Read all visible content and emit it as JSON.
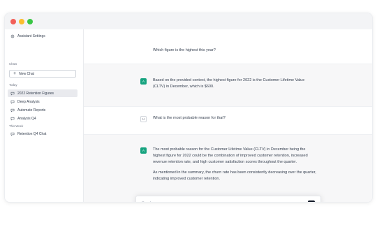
{
  "sidebar": {
    "settings_label": "Assistant Settings",
    "chats_caption": "Chats",
    "new_chat_label": "New Chat",
    "today_caption": "Today",
    "today_items": [
      {
        "label": "2022 Retention Figures",
        "active": true
      },
      {
        "label": "Deep Analysis",
        "active": false
      },
      {
        "label": "Automate Reports",
        "active": false
      },
      {
        "label": "Analysis Q4",
        "active": false
      }
    ],
    "week_caption": "This Week",
    "week_items": [
      {
        "label": "Retention Q4 Chat",
        "active": false
      }
    ]
  },
  "conversation": [
    {
      "role": "user",
      "avatar": "",
      "text": "Which figure is the highest this year?"
    },
    {
      "role": "assistant",
      "avatar": "A",
      "text": "Based on the provided context, the highest figure for 2022 is the Customer Lifetime Value (CLTV) in December, which is $600."
    },
    {
      "role": "user",
      "avatar": "U",
      "text": "What is the most probable reason for that?"
    },
    {
      "role": "assistant",
      "avatar": "A",
      "paragraphs": [
        "The most probable reason for the Customer Lifetime Value (CLTV) in December being the highest figure for 2022 could be the combination of improved customer retention, increased revenue retention rate, and high customer satisfaction scores throughout the quarter.",
        "As mentioned in the summary, the churn rate has been consistently decreasing over the quarter, indicating improved customer retention."
      ]
    }
  ],
  "composer": {
    "placeholder": "Send a message..."
  },
  "colors": {
    "assistant_avatar": "#16a37f",
    "send_button": "#111827",
    "active_item": "#e9eaee"
  }
}
